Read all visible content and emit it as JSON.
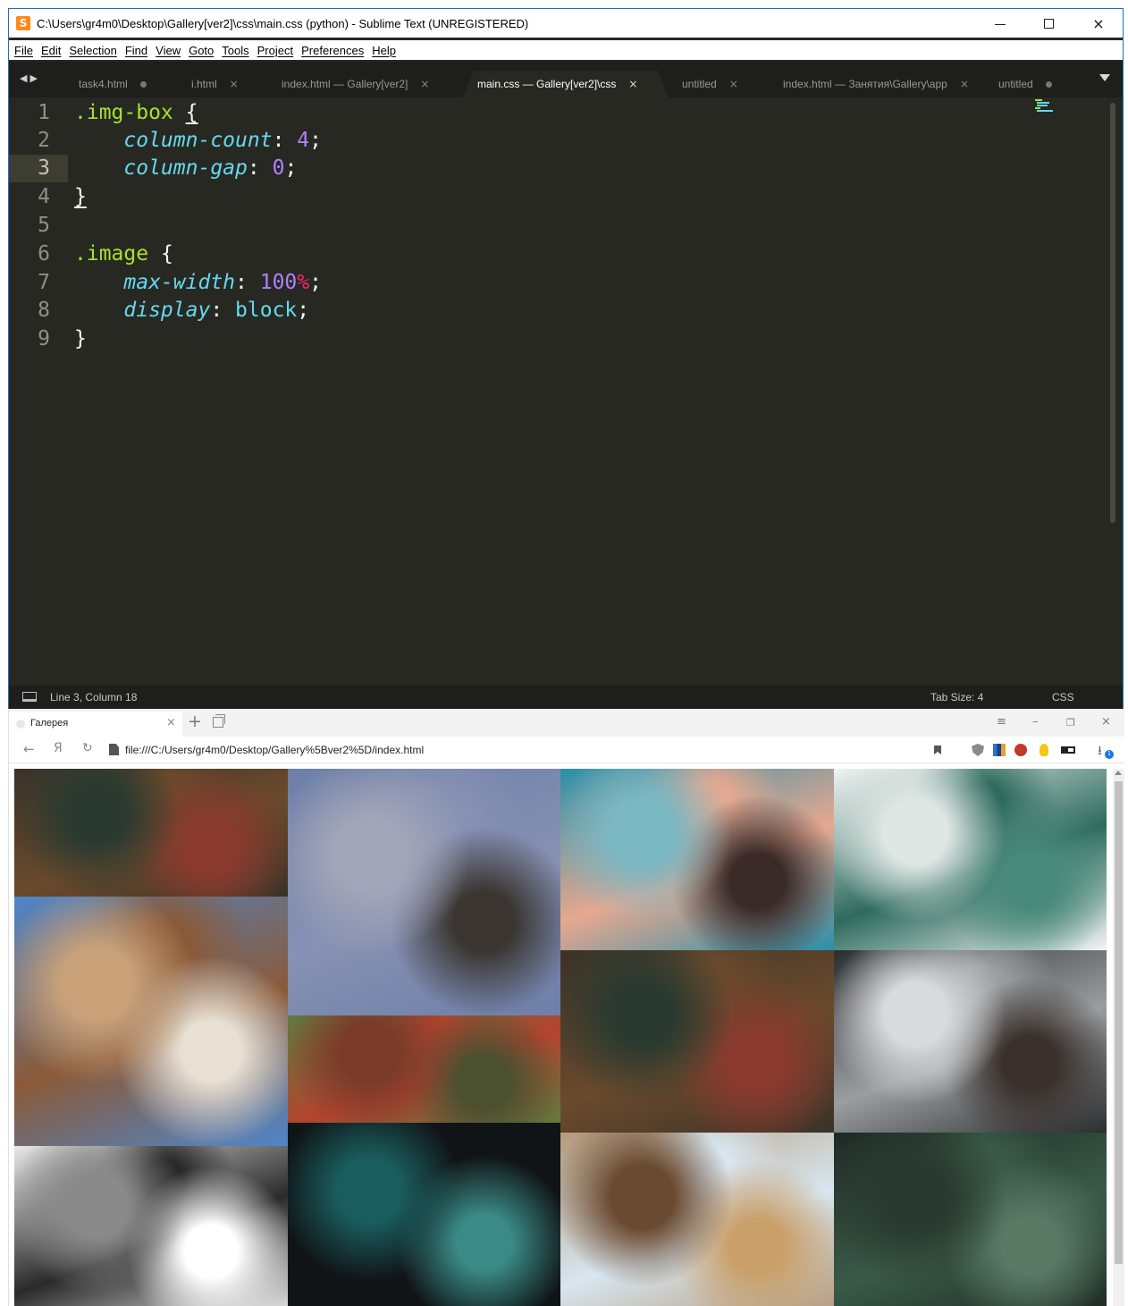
{
  "sublime": {
    "window_title": "C:\\Users\\gr4m0\\Desktop\\Gallery[ver2]\\css\\main.css (python) - Sublime Text (UNREGISTERED)",
    "menu": [
      "File",
      "Edit",
      "Selection",
      "Find",
      "View",
      "Goto",
      "Tools",
      "Project",
      "Preferences",
      "Help"
    ],
    "tabs": [
      {
        "label": "task4.html",
        "state": "dirty"
      },
      {
        "label": "i.html",
        "state": "close"
      },
      {
        "label": "index.html — Gallery[ver2]",
        "state": "close"
      },
      {
        "label": "main.css — Gallery[ver2]\\css",
        "state": "close",
        "active": true
      },
      {
        "label": "untitled",
        "state": "close"
      },
      {
        "label": "index.html — Занятия\\Gallery\\app",
        "state": "close"
      },
      {
        "label": "untitled",
        "state": "dirty"
      }
    ],
    "line_numbers": [
      "1",
      "2",
      "3",
      "4",
      "5",
      "6",
      "7",
      "8",
      "9"
    ],
    "current_line": 3,
    "code": {
      "l1_selector": ".img-box",
      "l1_brace": "{",
      "l2_prop": "column-count",
      "l2_value": "4",
      "l3_prop": "column-gap",
      "l3_value": "0",
      "l4_brace": "}",
      "l6_selector": ".image",
      "l6_brace": "{",
      "l7_prop": "max-width",
      "l7_value": "100",
      "l7_unit": "%",
      "l8_prop": "display",
      "l8_value": "block",
      "l9_brace": "}",
      "colon": ":",
      "semicolon": ";"
    },
    "status": {
      "position": "Line 3, Column 18",
      "tab_size": "Tab Size: 4",
      "syntax": "CSS"
    },
    "colors": {
      "background": "#272822",
      "selector": "#a6e22e",
      "property": "#66d9ef",
      "number": "#ae81ff",
      "unit": "#f92672"
    }
  },
  "browser": {
    "tab_title": "Галерея",
    "url": "file:///C:/Users/gr4m0/Desktop/Gallery%5Bver2%5D/index.html",
    "back_icon": "←",
    "yandex_icon": "Я",
    "reload_icon": "↻",
    "new_tab_icon": "+",
    "close_icon": "×",
    "menu_icon": "≡",
    "minimize_icon": "–",
    "restore_icon": "❐",
    "download_badge": "1"
  },
  "gallery": {
    "columns": 4,
    "column_gap": 0,
    "photos": [
      {
        "name": "photo-berries-leaves-1",
        "subject": "berries and leaves",
        "colors": [
          "#3a3228",
          "#6b4a2c",
          "#2b3a30",
          "#8a3a2e"
        ]
      },
      {
        "name": "photo-city-buildings-car",
        "subject": "city buildings and car",
        "colors": [
          "#4f86c9",
          "#8a5a38",
          "#c9a27a",
          "#e8e0d4"
        ]
      },
      {
        "name": "photo-monochrome-people-walking",
        "subject": "people walking black and white",
        "colors": [
          "#e8e8e8",
          "#2a2a2a",
          "#8a8a8a",
          "#ffffff"
        ]
      },
      {
        "name": "photo-sprinter",
        "subject": "sprinting athlete",
        "colors": [
          "#6d7fa8",
          "#8791b3",
          "#a3a6b8",
          "#3a3530"
        ]
      },
      {
        "name": "photo-ivy-house",
        "subject": "ivy covered house",
        "colors": [
          "#5f7b3e",
          "#b4432e",
          "#7a3a2a",
          "#4a5030"
        ]
      },
      {
        "name": "photo-aerial-beach",
        "subject": "aerial beach",
        "colors": [
          "#0f1416",
          "#111416",
          "#1a5d5e",
          "#3a8a86"
        ]
      },
      {
        "name": "photo-aerial-pink-water",
        "subject": "aerial pink rock and water",
        "colors": [
          "#2a8fa8",
          "#e6a890",
          "#7ab8c4",
          "#3a2a28"
        ]
      },
      {
        "name": "photo-berries-leaves-2",
        "subject": "berries and leaves",
        "colors": [
          "#3a3228",
          "#6b4a2c",
          "#2b3a30",
          "#8a3a2e"
        ]
      },
      {
        "name": "photo-city-street",
        "subject": "city street with skyscrapers",
        "colors": [
          "#b49a7a",
          "#d8e6f0",
          "#6a4a30",
          "#c9a06a"
        ]
      },
      {
        "name": "photo-fern-fog",
        "subject": "fern in fog",
        "colors": [
          "#f2f4f3",
          "#2e6b5e",
          "#dfe7e4",
          "#4a8a7a"
        ]
      },
      {
        "name": "photo-mountain-moon",
        "subject": "mountain and moon",
        "colors": [
          "#2a2e30",
          "#9a9ea0",
          "#d8dadb",
          "#3a302c"
        ]
      },
      {
        "name": "photo-dark-leaves",
        "subject": "dark green leaves",
        "colors": [
          "#1e2a24",
          "#3a5a48",
          "#2a3a30",
          "#5a7a66"
        ]
      }
    ]
  }
}
